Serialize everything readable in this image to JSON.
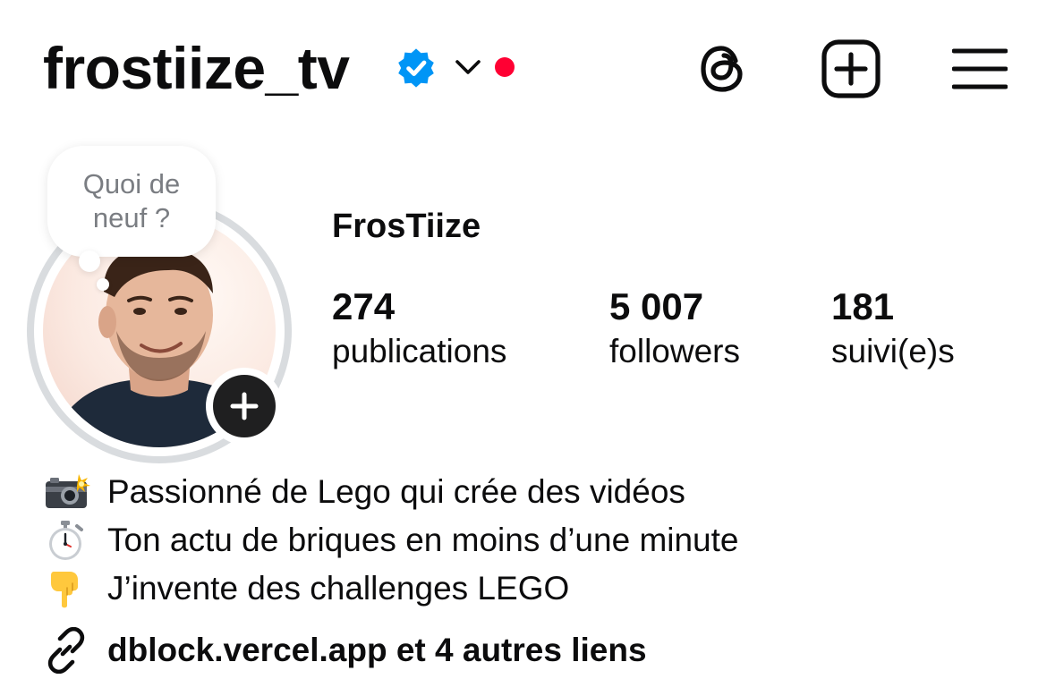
{
  "header": {
    "username": "frostiize_tv",
    "verified_color": "#0095f6",
    "notification_dot_color": "#ff0033",
    "icons": [
      "verified-badge-icon",
      "chevron-down-icon",
      "threads-icon",
      "create-plus-icon",
      "menu-icon"
    ]
  },
  "note": {
    "text_line1": "Quoi de",
    "text_line2": "neuf ?"
  },
  "profile": {
    "display_name": "FrosTiize",
    "stats": {
      "posts_count": "274",
      "posts_label": "publications",
      "followers_count": "5 007",
      "followers_label": "followers",
      "following_count": "181",
      "following_label": "suivi(e)s"
    }
  },
  "bio": {
    "lines": [
      {
        "icon": "📸",
        "text": "Passionné de Lego qui crée des vidéos"
      },
      {
        "icon": "⏱️",
        "text": "Ton actu de briques en moins d’une minute"
      },
      {
        "icon": "👇",
        "text": "J’invente des challenges LEGO"
      }
    ],
    "link_text": "dblock.vercel.app et 4 autres liens"
  }
}
